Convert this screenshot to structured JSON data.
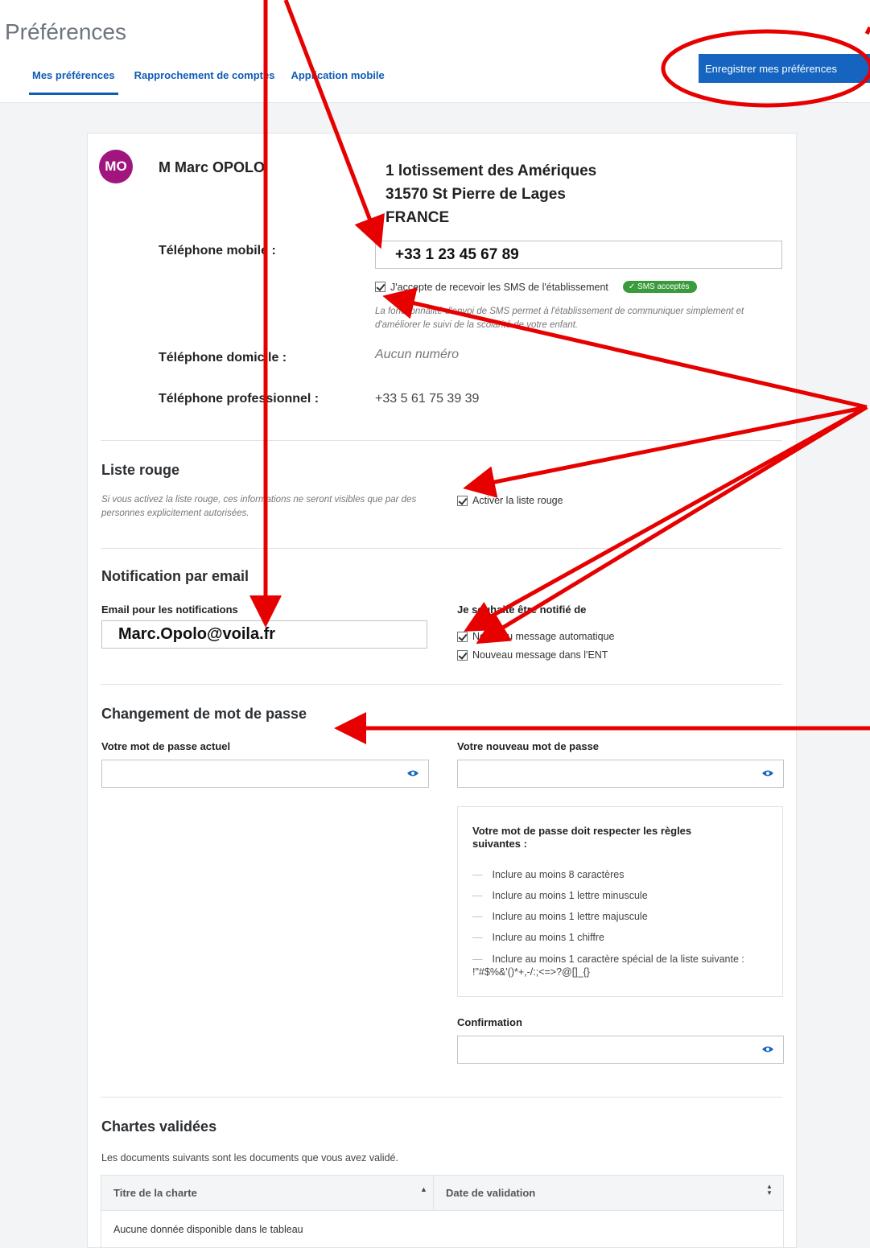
{
  "header": {
    "title": "Préférences",
    "tabs": [
      {
        "label": "Mes préférences",
        "active": true
      },
      {
        "label": "Rapprochement de comptes"
      },
      {
        "label": "Application mobile"
      }
    ],
    "save_label": "Enregistrer mes préférences"
  },
  "profile": {
    "initials": "MO",
    "avatar_color": "#a0157e",
    "name": "M Marc OPOLO",
    "address": [
      "1 lotissement des Amériques",
      "31570 St Pierre de Lages",
      "FRANCE"
    ]
  },
  "phones": {
    "mobile_label": "Téléphone mobile :",
    "mobile_value": "+33 1 23 45 67 89",
    "sms_checkbox_label": "J'accepte de recevoir les SMS de l'établissement",
    "sms_checked": true,
    "sms_badge": "SMS acceptés",
    "sms_hint": "La fonctionnalité d'envoi de SMS permet à l'établissement de communiquer simplement et d'améliorer le suivi de la scolarité de votre enfant.",
    "home_label": "Téléphone domicile :",
    "home_value": "Aucun numéro",
    "work_label": "Téléphone professionnel :",
    "work_value": "+33 5 61 75 39 39"
  },
  "liste_rouge": {
    "title": "Liste rouge",
    "hint": "Si vous activez la liste rouge, ces informations ne seront visibles que par des personnes explicitement autorisées.",
    "checkbox_label": "Activer la liste rouge",
    "checked": true
  },
  "email": {
    "title": "Notification par email",
    "field_label": "Email pour les notifications",
    "value": "Marc.Opolo@voila.fr",
    "notify_label": "Je souhaite être notifié de",
    "options": [
      {
        "label": "Nouveau message automatique",
        "checked": true
      },
      {
        "label": "Nouveau message dans l'ENT",
        "checked": true
      }
    ]
  },
  "password": {
    "title": "Changement de mot de passe",
    "current_label": "Votre mot de passe actuel",
    "new_label": "Votre nouveau mot de passe",
    "rules_title": "Votre mot de passe doit respecter les règles suivantes :",
    "rules": [
      "Inclure au moins 8 caractères",
      "Inclure au moins 1 lettre minuscule",
      "Inclure au moins 1 lettre majuscule",
      "Inclure au moins 1 chiffre",
      "Inclure au moins 1 caractère spécial de la liste suivante : !\"#$%&'()*+,-/:;<=>?@[]_{}"
    ],
    "confirm_label": "Confirmation"
  },
  "chartes": {
    "title": "Chartes validées",
    "description": "Les documents suivants sont les documents que vous avez validé.",
    "columns": [
      "Titre de la charte",
      "Date de validation"
    ],
    "empty": "Aucune donnée disponible dans le tableau"
  },
  "colors": {
    "accent": "#1565c0",
    "annotation": "#e60000",
    "badge": "#3a9b3c"
  }
}
